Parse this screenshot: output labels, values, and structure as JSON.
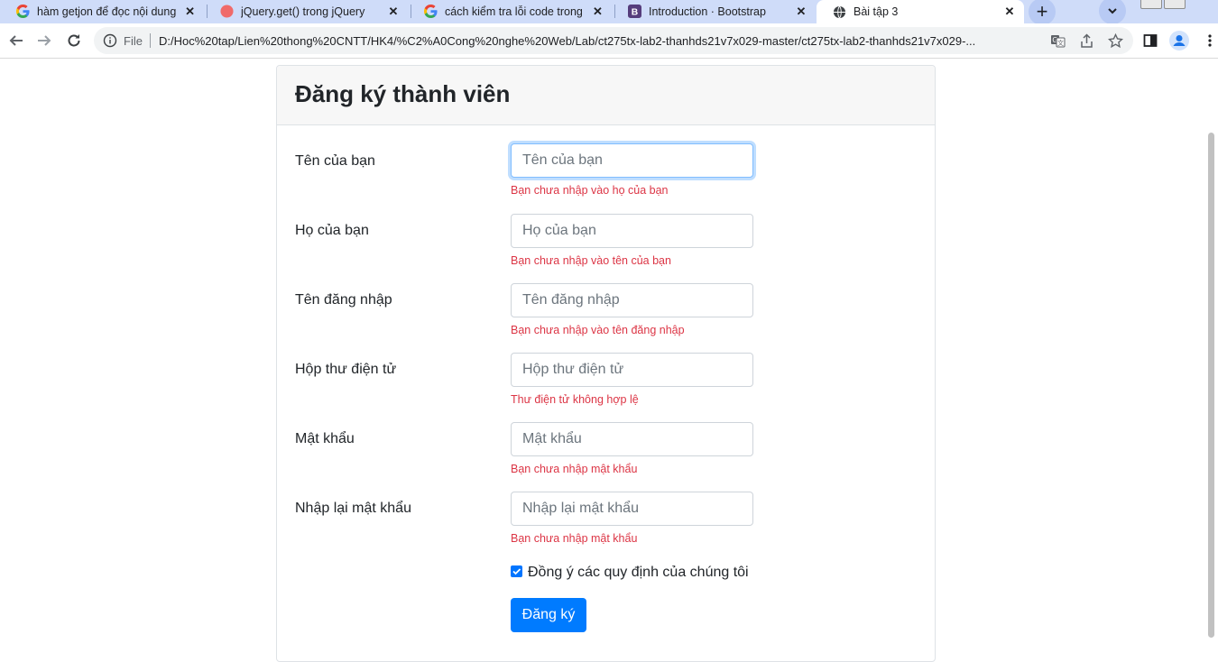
{
  "browser": {
    "tabs": [
      {
        "title": "hàm getjon để đọc nội dung từ",
        "icon": "google-icon"
      },
      {
        "title": "jQuery.get() trong jQuery",
        "icon": "site-icon"
      },
      {
        "title": "cách kiểm tra lỗi code trong vi",
        "icon": "google-icon"
      },
      {
        "title": "Introduction · Bootstrap",
        "icon": "bootstrap-icon"
      },
      {
        "title": "Bài tập 3",
        "icon": "globe-icon",
        "active": true
      }
    ],
    "omnibox": {
      "scheme_label": "File",
      "url": "D:/Hoc%20tap/Lien%20thong%20CNTT/HK4/%C2%A0Cong%20nghe%20Web/Lab/ct275tx-lab2-thanhds21v7x029-master/ct275tx-lab2-thanhds21v7x029-..."
    }
  },
  "form": {
    "title": "Đăng ký thành viên",
    "fields": [
      {
        "label": "Tên của bạn",
        "placeholder": "Tên của bạn",
        "value": "",
        "error": "Bạn chưa nhập vào họ của bạn"
      },
      {
        "label": "Họ của bạn",
        "placeholder": "Họ của bạn",
        "value": "",
        "error": "Bạn chưa nhập vào tên của bạn"
      },
      {
        "label": "Tên đăng nhập",
        "placeholder": "Tên đăng nhập",
        "value": "",
        "error": "Bạn chưa nhập vào tên đăng nhập"
      },
      {
        "label": "Hộp thư điện tử",
        "placeholder": "Hộp thư điện tử",
        "value": "",
        "error": "Thư điện tử không hợp lệ"
      },
      {
        "label": "Mật khẩu",
        "placeholder": "Mật khẩu",
        "value": "",
        "error": "Bạn chưa nhập mật khẩu"
      },
      {
        "label": "Nhập lại mật khẩu",
        "placeholder": "Nhập lại mật khẩu",
        "value": "",
        "error": "Bạn chưa nhập mật khẩu"
      }
    ],
    "agree_label": "Đồng ý các quy định của chúng tôi",
    "agree_checked": true,
    "submit_label": "Đăng ký"
  },
  "colors": {
    "primary": "#007bff",
    "error": "#dc3545",
    "tabstrip": "#cfdcf9"
  }
}
